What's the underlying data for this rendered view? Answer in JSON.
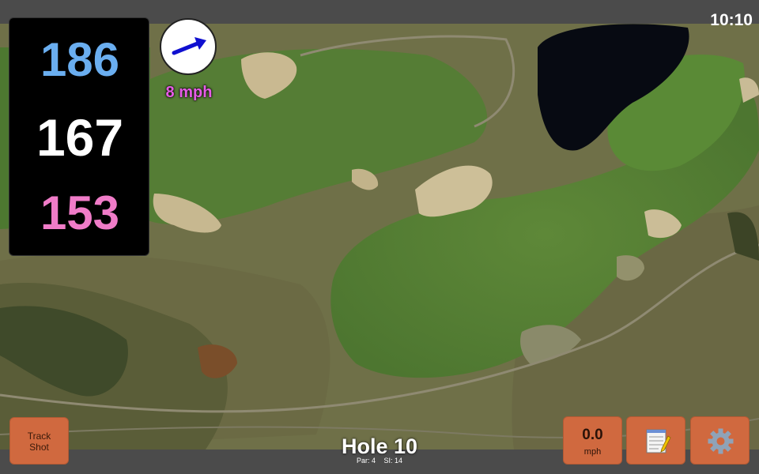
{
  "clock": "10:10",
  "distances": {
    "back": "186",
    "middle": "167",
    "front": "153",
    "colors": {
      "back": "#6aaef0",
      "middle": "#ffffff",
      "front": "#f07cc8"
    }
  },
  "wind": {
    "direction_icon": "arrow-right-up-icon",
    "speed_label": "8 mph",
    "speed_color": "#e65ce6"
  },
  "buttons": {
    "track_shot": {
      "line1": "Track",
      "line2": "Shot"
    },
    "wind": {
      "value": "0.0",
      "unit": "mph"
    },
    "scorecard_icon": "notepad-icon",
    "settings_icon": "gear-icon"
  },
  "hole": {
    "title": "Hole 10",
    "par": "Par: 4",
    "si": "SI: 14"
  },
  "colors": {
    "button": "#d0693f",
    "bar": "#4b4b4b"
  }
}
